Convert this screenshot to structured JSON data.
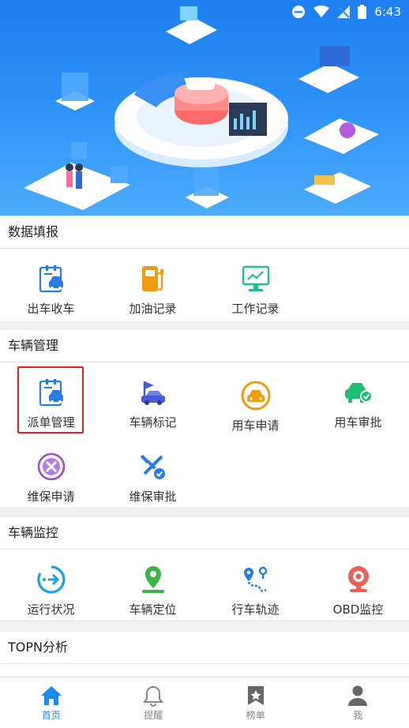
{
  "status_bar": {
    "time": "6:43"
  },
  "sections": {
    "data_entry": {
      "title": "数据填报",
      "items": [
        {
          "label": "出车收车",
          "icon": "clipboard-car-icon",
          "color": "#2a7be4"
        },
        {
          "label": "加油记录",
          "icon": "fuel-pump-icon",
          "color": "#f39c12"
        },
        {
          "label": "工作记录",
          "icon": "monitor-chart-icon",
          "color": "#1fbf8f"
        }
      ]
    },
    "vehicle_mgmt": {
      "title": "车辆管理",
      "items": [
        {
          "label": "派单管理",
          "icon": "clipboard-car-icon",
          "color": "#2a7be4",
          "selected": true
        },
        {
          "label": "车辆标记",
          "icon": "flag-car-icon",
          "color": "#4a5bd6"
        },
        {
          "label": "用车申请",
          "icon": "car-circle-icon",
          "color": "#f39c12"
        },
        {
          "label": "用车审批",
          "icon": "car-check-icon",
          "color": "#1ebe76"
        },
        {
          "label": "维保申请",
          "icon": "wrench-circle-icon",
          "color": "#9b4fd6"
        },
        {
          "label": "维保审批",
          "icon": "tools-check-icon",
          "color": "#2a7be4"
        }
      ]
    },
    "vehicle_monitor": {
      "title": "车辆监控",
      "items": [
        {
          "label": "运行状况",
          "icon": "circle-arrow-icon",
          "color": "#1aa3e8"
        },
        {
          "label": "车辆定位",
          "icon": "map-pin-icon",
          "color": "#3bb54a"
        },
        {
          "label": "行车轨迹",
          "icon": "route-icon",
          "color": "#2a7be4"
        },
        {
          "label": "OBD监控",
          "icon": "webcam-icon",
          "color": "#f0605a"
        }
      ]
    },
    "topn": {
      "title": "TOPN分析"
    }
  },
  "tabbar": {
    "tabs": [
      {
        "label": "首页",
        "icon": "home-icon",
        "active": true
      },
      {
        "label": "提醒",
        "icon": "bell-icon",
        "active": false
      },
      {
        "label": "榜单",
        "icon": "star-bookmark-icon",
        "active": false
      },
      {
        "label": "我",
        "icon": "user-icon",
        "active": false
      }
    ],
    "active_color": "#1a8cf0"
  }
}
